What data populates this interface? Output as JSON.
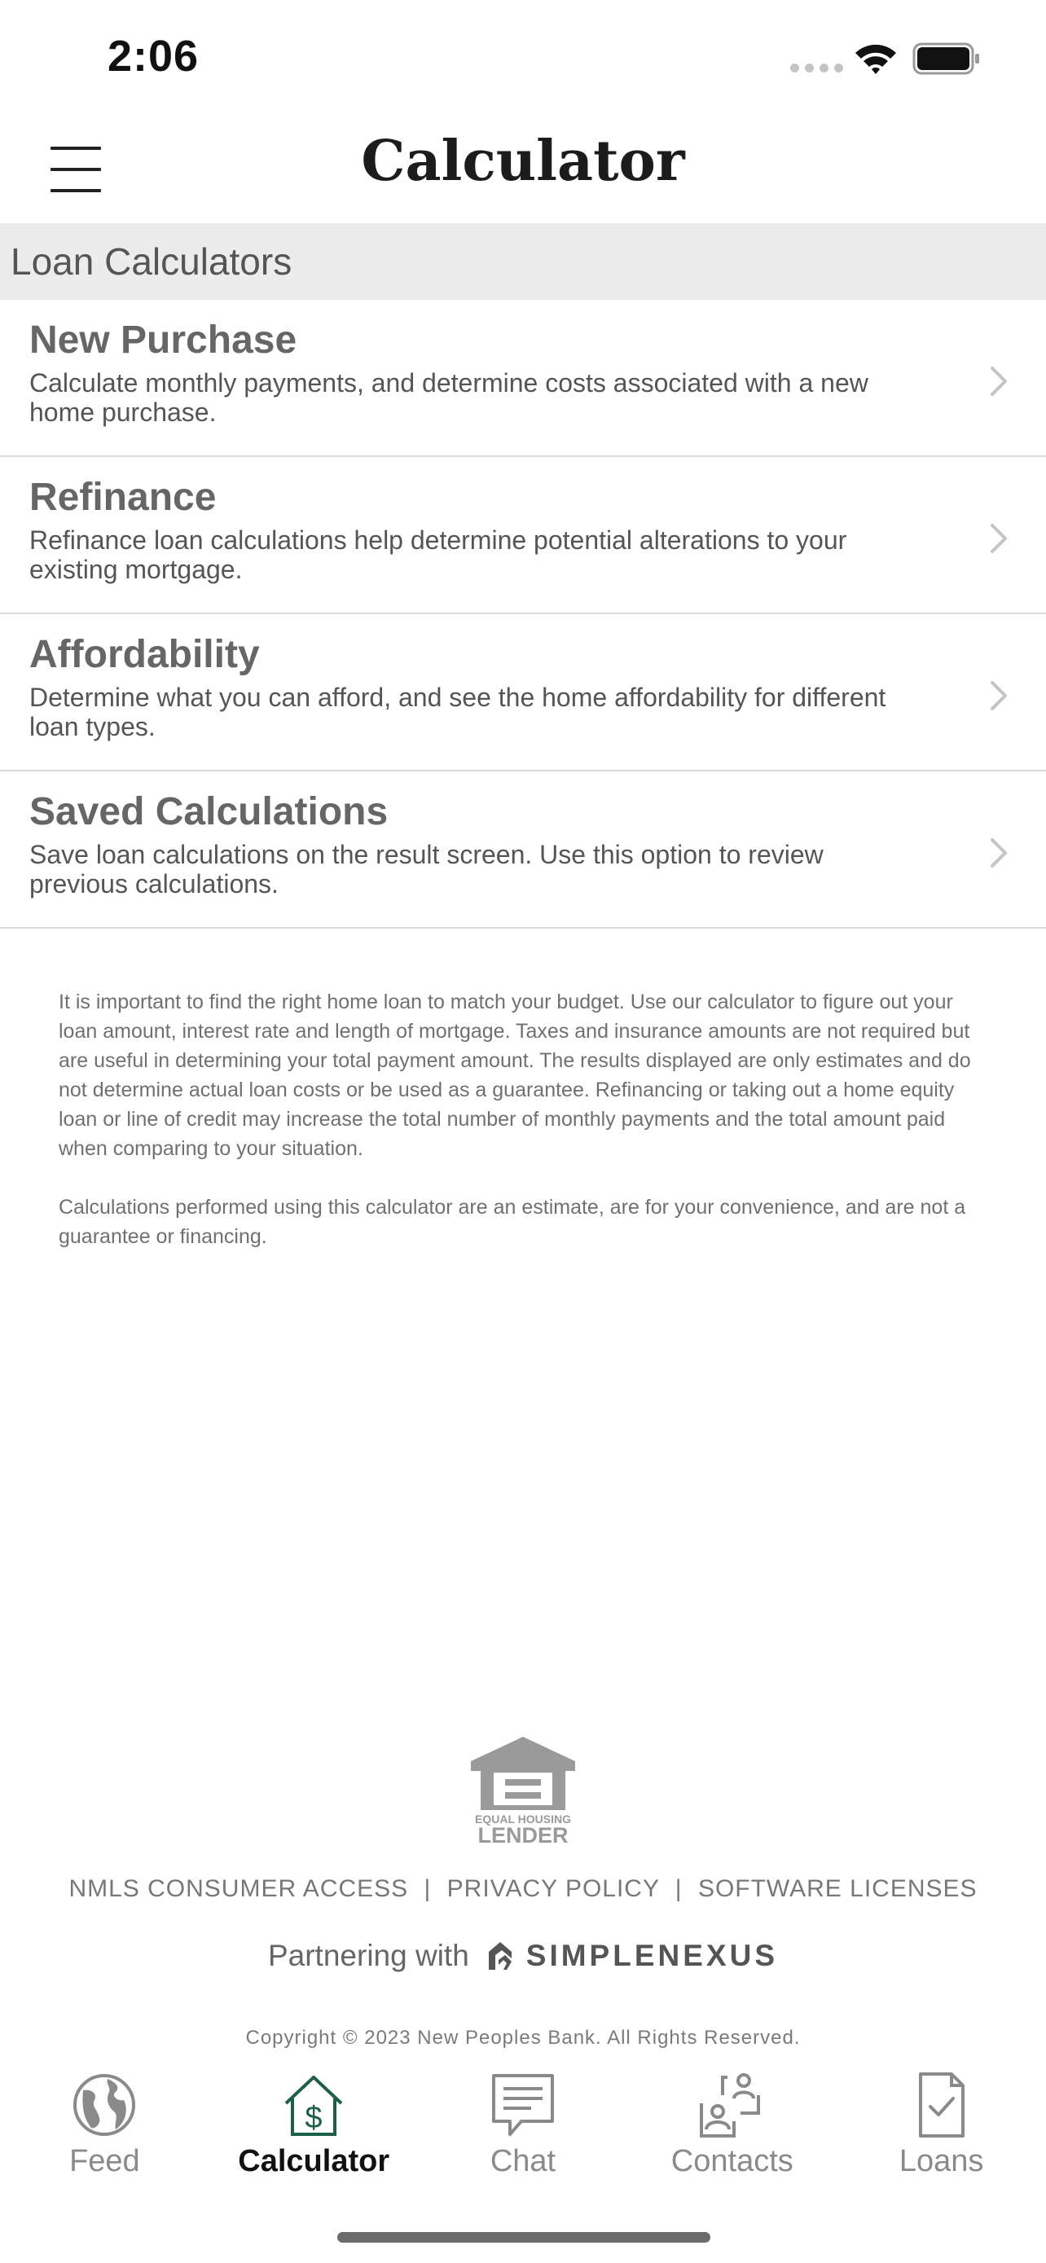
{
  "status_bar": {
    "time": "2:06"
  },
  "header": {
    "title": "Calculator"
  },
  "section": {
    "title": "Loan Calculators"
  },
  "calculators": [
    {
      "title": "New Purchase",
      "description": "Calculate monthly payments, and determine costs associated with a new home purchase."
    },
    {
      "title": "Refinance",
      "description": "Refinance loan calculations help determine potential alterations to your existing mortgage."
    },
    {
      "title": "Affordability",
      "description": "Determine what you can afford, and see the home affordability for different loan types."
    },
    {
      "title": "Saved Calculations",
      "description": "Save loan calculations on the result screen. Use this option to review previous calculations."
    }
  ],
  "disclaimer": {
    "p1": "It is important to find the right home loan to match your budget. Use our calculator to figure out your loan amount, interest rate and length of mortgage. Taxes and insurance amounts are not required but are useful in determining your total payment amount. The results displayed are only estimates and do not determine actual loan costs or be used as a guarantee. Refinancing or taking out a home equity loan or line of credit may increase the total number of monthly payments and the total amount paid when comparing to your situation.",
    "p2": "Calculations performed using this calculator are an estimate, are for your convenience, and are not a guarantee or financing."
  },
  "footer": {
    "ehl_line1": "EQUAL HOUSING",
    "ehl_line2": "LENDER",
    "links": [
      "NMLS CONSUMER ACCESS",
      "PRIVACY POLICY",
      "SOFTWARE LICENSES"
    ],
    "separator": "|",
    "partnering_text": "Partnering with",
    "partner_name": "SIMPLENEXUS",
    "copyright": "Copyright © 2023 New Peoples Bank. All Rights Reserved."
  },
  "tabs": [
    {
      "label": "Feed",
      "icon": "globe-icon",
      "active": false
    },
    {
      "label": "Calculator",
      "icon": "house-dollar-icon",
      "active": true
    },
    {
      "label": "Chat",
      "icon": "chat-icon",
      "active": false
    },
    {
      "label": "Contacts",
      "icon": "contacts-icon",
      "active": false
    },
    {
      "label": "Loans",
      "icon": "document-check-icon",
      "active": false
    }
  ],
  "colors": {
    "accent": "#1f5e4a",
    "section_bg": "#ececec",
    "inactive_tab": "#8a8a8a"
  }
}
